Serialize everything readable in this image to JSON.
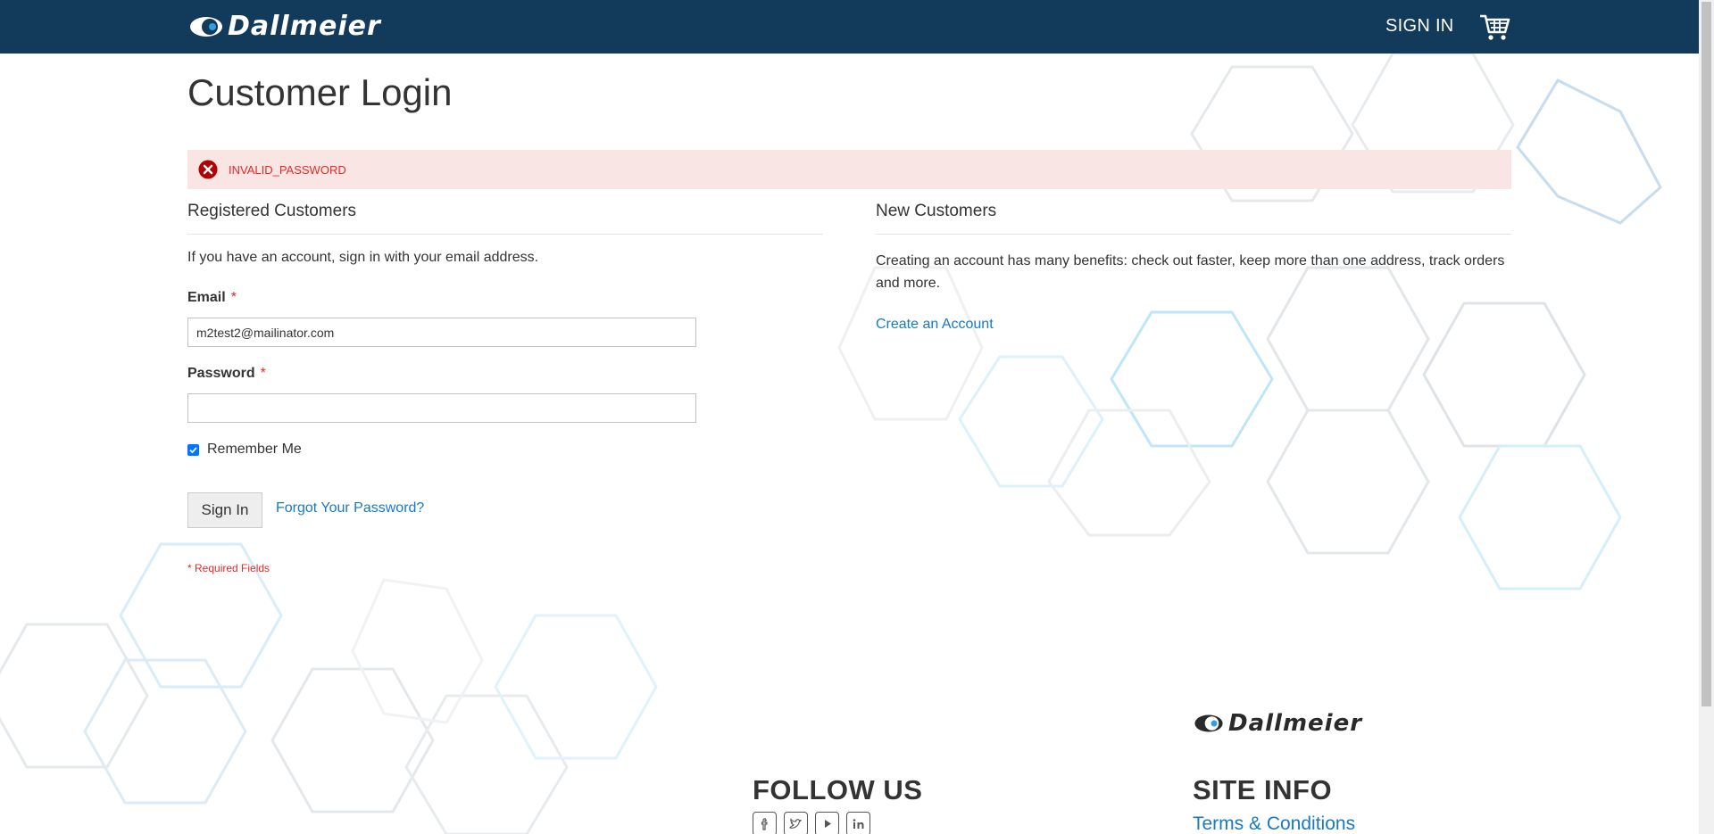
{
  "header": {
    "brand": "Dallmeier",
    "sign_in_label": "SIGN IN"
  },
  "page": {
    "title": "Customer Login"
  },
  "error": {
    "message": "INVALID_PASSWORD"
  },
  "registered": {
    "title": "Registered Customers",
    "intro": "If you have an account, sign in with your email address.",
    "email_label": "Email",
    "email_value": "m2test2@mailinator.com",
    "password_label": "Password",
    "password_value": "",
    "required_marker": "*",
    "remember_label": "Remember Me",
    "remember_checked": true,
    "sign_in_button": "Sign In",
    "forgot_link": "Forgot Your Password?",
    "required_note": "* Required Fields"
  },
  "new_customers": {
    "title": "New Customers",
    "description": "Creating an account has many benefits: check out faster, keep more than one address, track orders and more.",
    "create_link": "Create an Account"
  },
  "footer": {
    "brand": "Dallmeier",
    "follow_heading": "FOLLOW US",
    "social_icons": [
      "facebook-icon",
      "twitter-icon",
      "youtube-icon",
      "linkedin-icon"
    ],
    "site_info_heading": "SITE INFO",
    "terms_link": "Terms & Conditions"
  },
  "colors": {
    "header_bg": "#123a5a",
    "link": "#1979c3",
    "error_bg": "#fae5e5",
    "error_text": "#e02b27"
  }
}
